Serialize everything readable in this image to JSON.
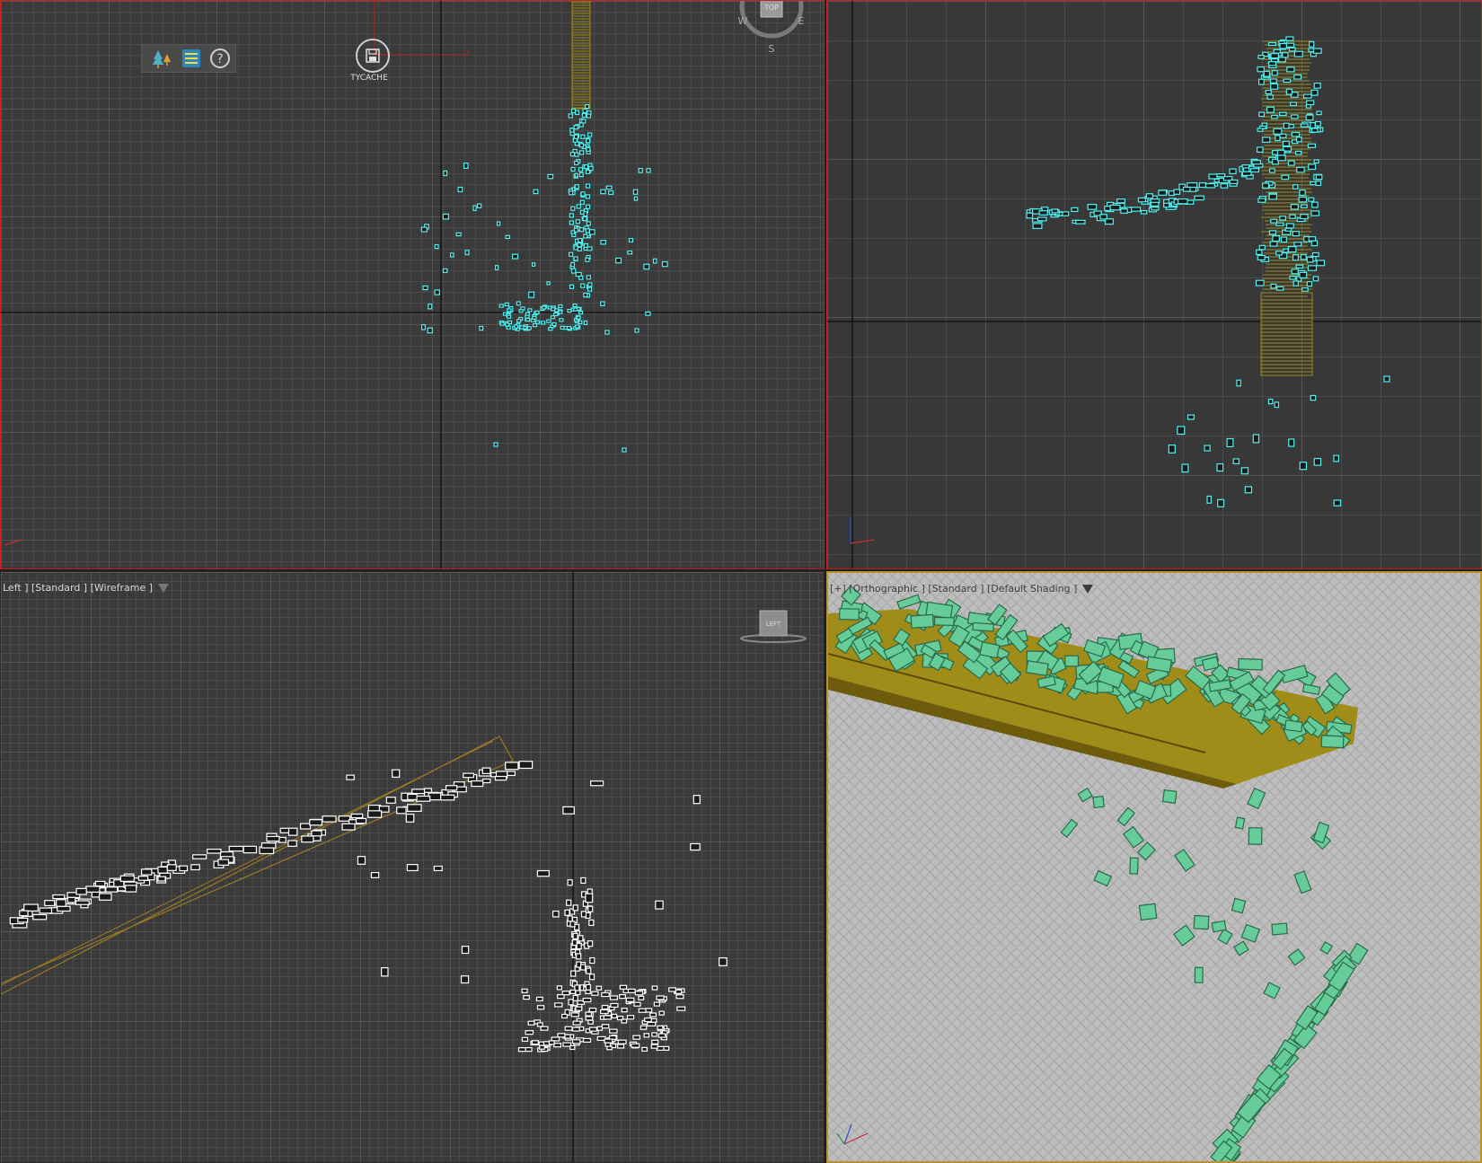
{
  "viewports": {
    "top": {
      "toolbar": {
        "icons": [
          "tree-outliner-icon",
          "list-icon",
          "help-icon"
        ]
      },
      "tycache": {
        "label": "TYCACHE",
        "icon": "save-disk-icon"
      },
      "viewcube": {
        "face": "TOP",
        "north_label": "",
        "west_label": "W",
        "east_label": "E",
        "south_label": "S"
      }
    },
    "front": {},
    "left": {
      "label": "Left ] [Standard ] [Wireframe ]",
      "viewcube": {
        "face": "LEFT"
      }
    },
    "perspective": {
      "label": "[+] [Orthographic ] [Standard ] [Default Shading ]"
    }
  },
  "colors": {
    "viewport_bg": "#3a3a3a",
    "grid_minor": "#4b4b4b",
    "grid_major": "#565656",
    "axis_line": "#141414",
    "active_border": "#b8922c",
    "viewport_border": "#c81e1e",
    "particle_cyan": "#4ff0f0",
    "particle_white": "#ffffff",
    "chute_gold": "#a08c16",
    "shaded_particles": "#66cc99",
    "shaded_floor": "#bcbcbc"
  }
}
